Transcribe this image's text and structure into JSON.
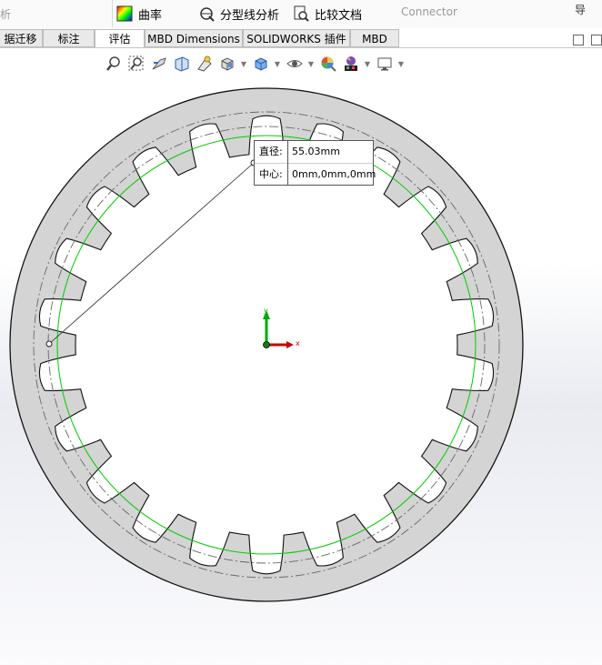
{
  "ribbon": {
    "left_fragment": "析",
    "curvature_label": "曲率",
    "parting_line_label": "分型线分析",
    "compare_docs_label": "比较文档",
    "connector_label": "Connector",
    "topright_fragment": "导"
  },
  "tabs": [
    {
      "label": "据迁移",
      "active": false
    },
    {
      "label": "标注",
      "active": false
    },
    {
      "label": "评估",
      "active": true
    },
    {
      "label": "MBD Dimensions",
      "active": false
    },
    {
      "label": "SOLIDWORKS 插件",
      "active": false
    },
    {
      "label": "MBD",
      "active": false
    }
  ],
  "hud_icons": [
    "zoom-to-fit-icon",
    "zoom-area-icon",
    "previous-view-icon",
    "section-view-icon",
    "dynamic-annotation-icon",
    "view-orientation-icon",
    "display-style-icon",
    "hide-show-items-icon",
    "edit-appearance-icon",
    "apply-scene-icon",
    "view-settings-icon"
  ],
  "measure": {
    "diameter_label": "直径:",
    "diameter_value": "55.03mm",
    "center_label": "中心:",
    "center_value": "0mm,0mm,0mm"
  },
  "triad": {
    "x_label": "x",
    "y_label": "y"
  },
  "gear": {
    "teeth": 22
  },
  "colors": {
    "accent_green": "#00cc00",
    "ring_fill": "#d4d4d4",
    "x_axis": "#cc0000",
    "y_axis": "#00aa00"
  }
}
